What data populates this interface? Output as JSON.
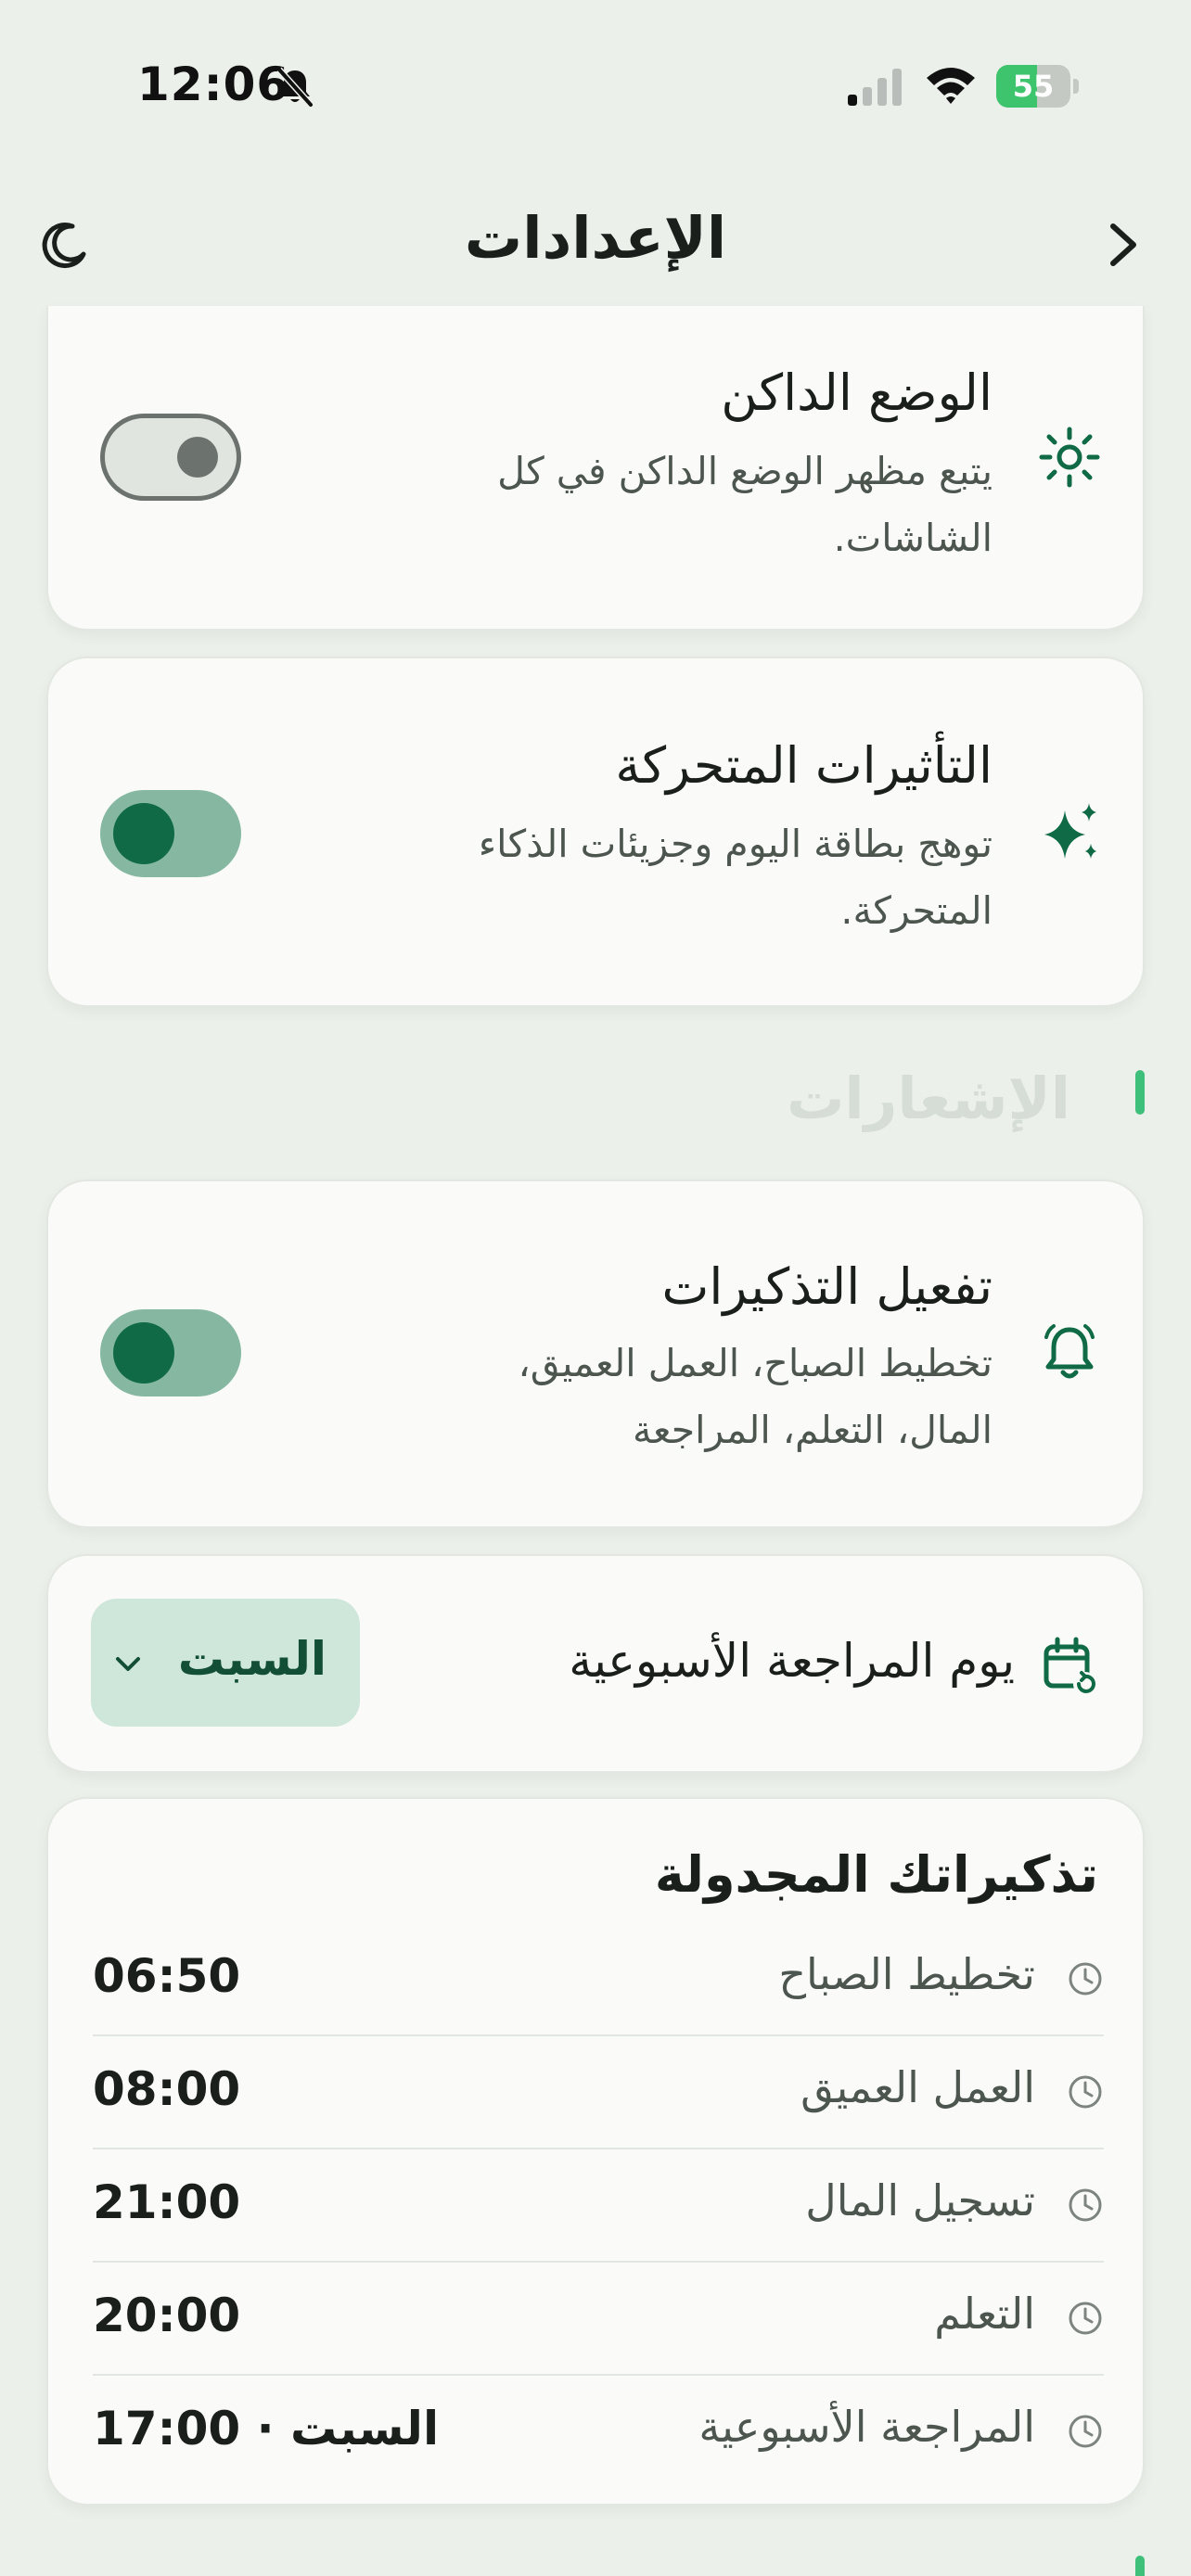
{
  "status_bar": {
    "time": "12:06",
    "battery": "55",
    "battery_level": 0.55
  },
  "header": {
    "title": "الإعدادات"
  },
  "settings": {
    "dark_mode": {
      "title": "الوضع الداكن",
      "description": "يتبع مظهر الوضع الداكن في كل الشاشات.",
      "enabled": false
    },
    "animations": {
      "title": "التأثيرات المتحركة",
      "description": "توهج بطاقة اليوم وجزيئات الذكاء المتحركة.",
      "enabled": true
    }
  },
  "notifications": {
    "section_title": "الإشعارات",
    "reminders": {
      "title": "تفعيل التذكيرات",
      "description": "تخطيط الصباح، العمل العميق، المال، التعلم، المراجعة",
      "enabled": true
    },
    "weekly_review": {
      "label": "يوم المراجعة الأسبوعية",
      "selected": "السبت"
    },
    "schedule": {
      "title": "تذكيراتك المجدولة",
      "items": [
        {
          "label": "تخطيط الصباح",
          "time": "06:50"
        },
        {
          "label": "العمل العميق",
          "time": "08:00"
        },
        {
          "label": "تسجيل المال",
          "time": "21:00"
        },
        {
          "label": "التعلم",
          "time": "20:00"
        },
        {
          "label": "المراجعة الأسبوعية",
          "time": "السبت · 17:00"
        }
      ]
    }
  },
  "colors": {
    "accent": "#0f6a45",
    "toggle_track_on": "#86b7a0",
    "section_accent": "#3fc07a",
    "background": "#ecf0ea"
  }
}
